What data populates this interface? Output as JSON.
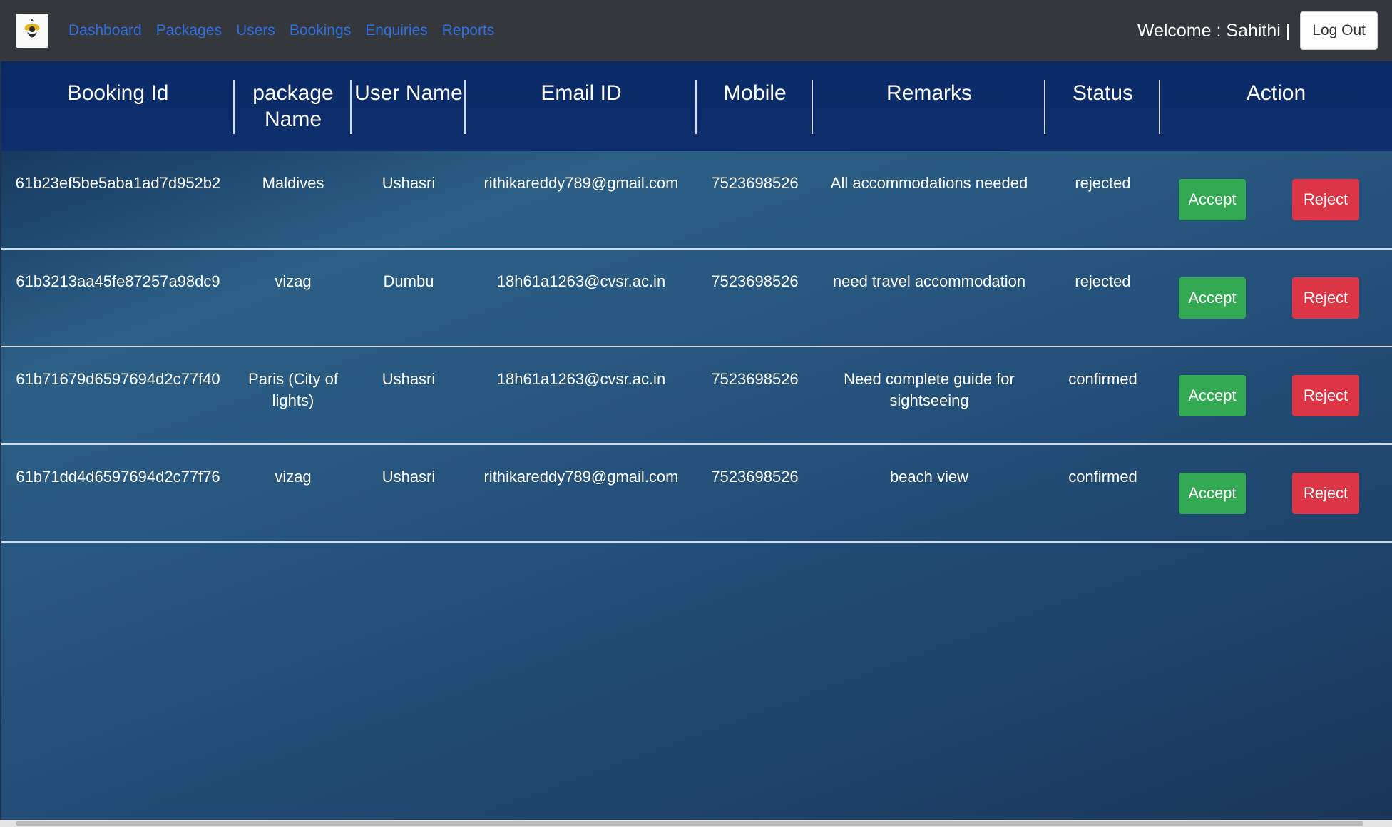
{
  "nav": {
    "links": [
      "Dashboard",
      "Packages",
      "Users",
      "Bookings",
      "Enquiries",
      "Reports"
    ],
    "welcome": "Welcome : Sahithi |",
    "logout": "Log Out"
  },
  "table": {
    "headers": [
      "Booking Id",
      "package Name",
      "User Name",
      "Email ID",
      "Mobile",
      "Remarks",
      "Status",
      "Action"
    ],
    "rows": [
      {
        "id": "61b23ef5be5aba1ad7d952b2",
        "package": "Maldives",
        "user": "Ushasri",
        "email": "rithikareddy789@gmail.com",
        "mobile": "7523698526",
        "remarks": "All accommodations needed",
        "status": "rejected"
      },
      {
        "id": "61b3213aa45fe87257a98dc9",
        "package": "vizag",
        "user": "Dumbu",
        "email": "18h61a1263@cvsr.ac.in",
        "mobile": "7523698526",
        "remarks": "need travel accommodation",
        "status": "rejected"
      },
      {
        "id": "61b71679d6597694d2c77f40",
        "package": "Paris (City of lights)",
        "user": "Ushasri",
        "email": "18h61a1263@cvsr.ac.in",
        "mobile": "7523698526",
        "remarks": "Need complete guide for sightseeing",
        "status": "confirmed"
      },
      {
        "id": "61b71dd4d6597694d2c77f76",
        "package": "vizag",
        "user": "Ushasri",
        "email": "rithikareddy789@gmail.com",
        "mobile": "7523698526",
        "remarks": "beach view",
        "status": "confirmed"
      }
    ],
    "accept_label": "Accept",
    "reject_label": "Reject"
  },
  "colors": {
    "navbar": "#34373b",
    "nav_link": "#2f6fe4",
    "accept": "#32a852",
    "reject": "#dc3545"
  }
}
